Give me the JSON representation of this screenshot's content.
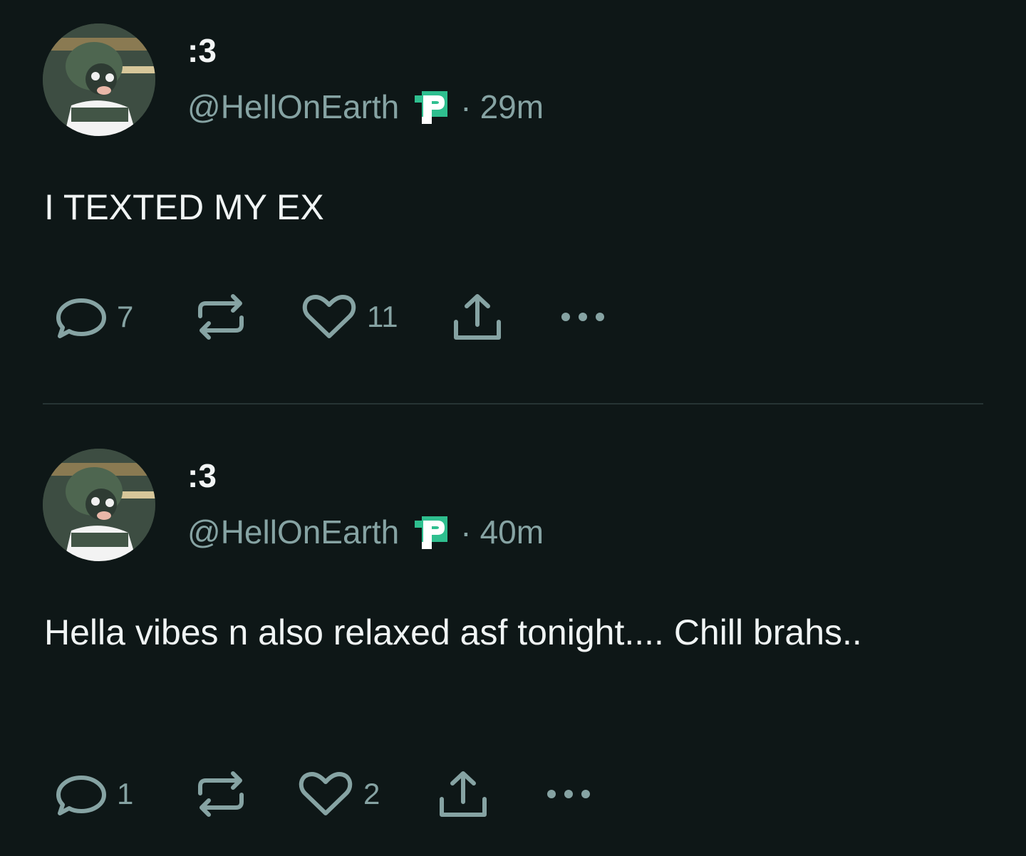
{
  "colors": {
    "background": "#0e1717",
    "text_primary": "#f0f4f4",
    "text_secondary": "#86a3a3",
    "divider": "#263434",
    "badge_green": "#2fbf8f"
  },
  "icons": {
    "reply": "speech-bubble-icon",
    "repost": "repost-arrows-icon",
    "like": "heart-icon",
    "share": "share-upload-icon",
    "more": "ellipsis-icon",
    "badge": "green-p-badge-icon"
  },
  "posts": [
    {
      "display_name": ":3",
      "handle": "@HellOnEarth",
      "separator": "·",
      "time": "29m",
      "text": "I TEXTED MY EX",
      "reply_count": "7",
      "like_count": "11"
    },
    {
      "display_name": ":3",
      "handle": "@HellOnEarth",
      "separator": "·",
      "time": "40m",
      "text": "Hella vibes n also relaxed asf tonight.... Chill brahs..",
      "reply_count": "1",
      "like_count": "2"
    }
  ]
}
